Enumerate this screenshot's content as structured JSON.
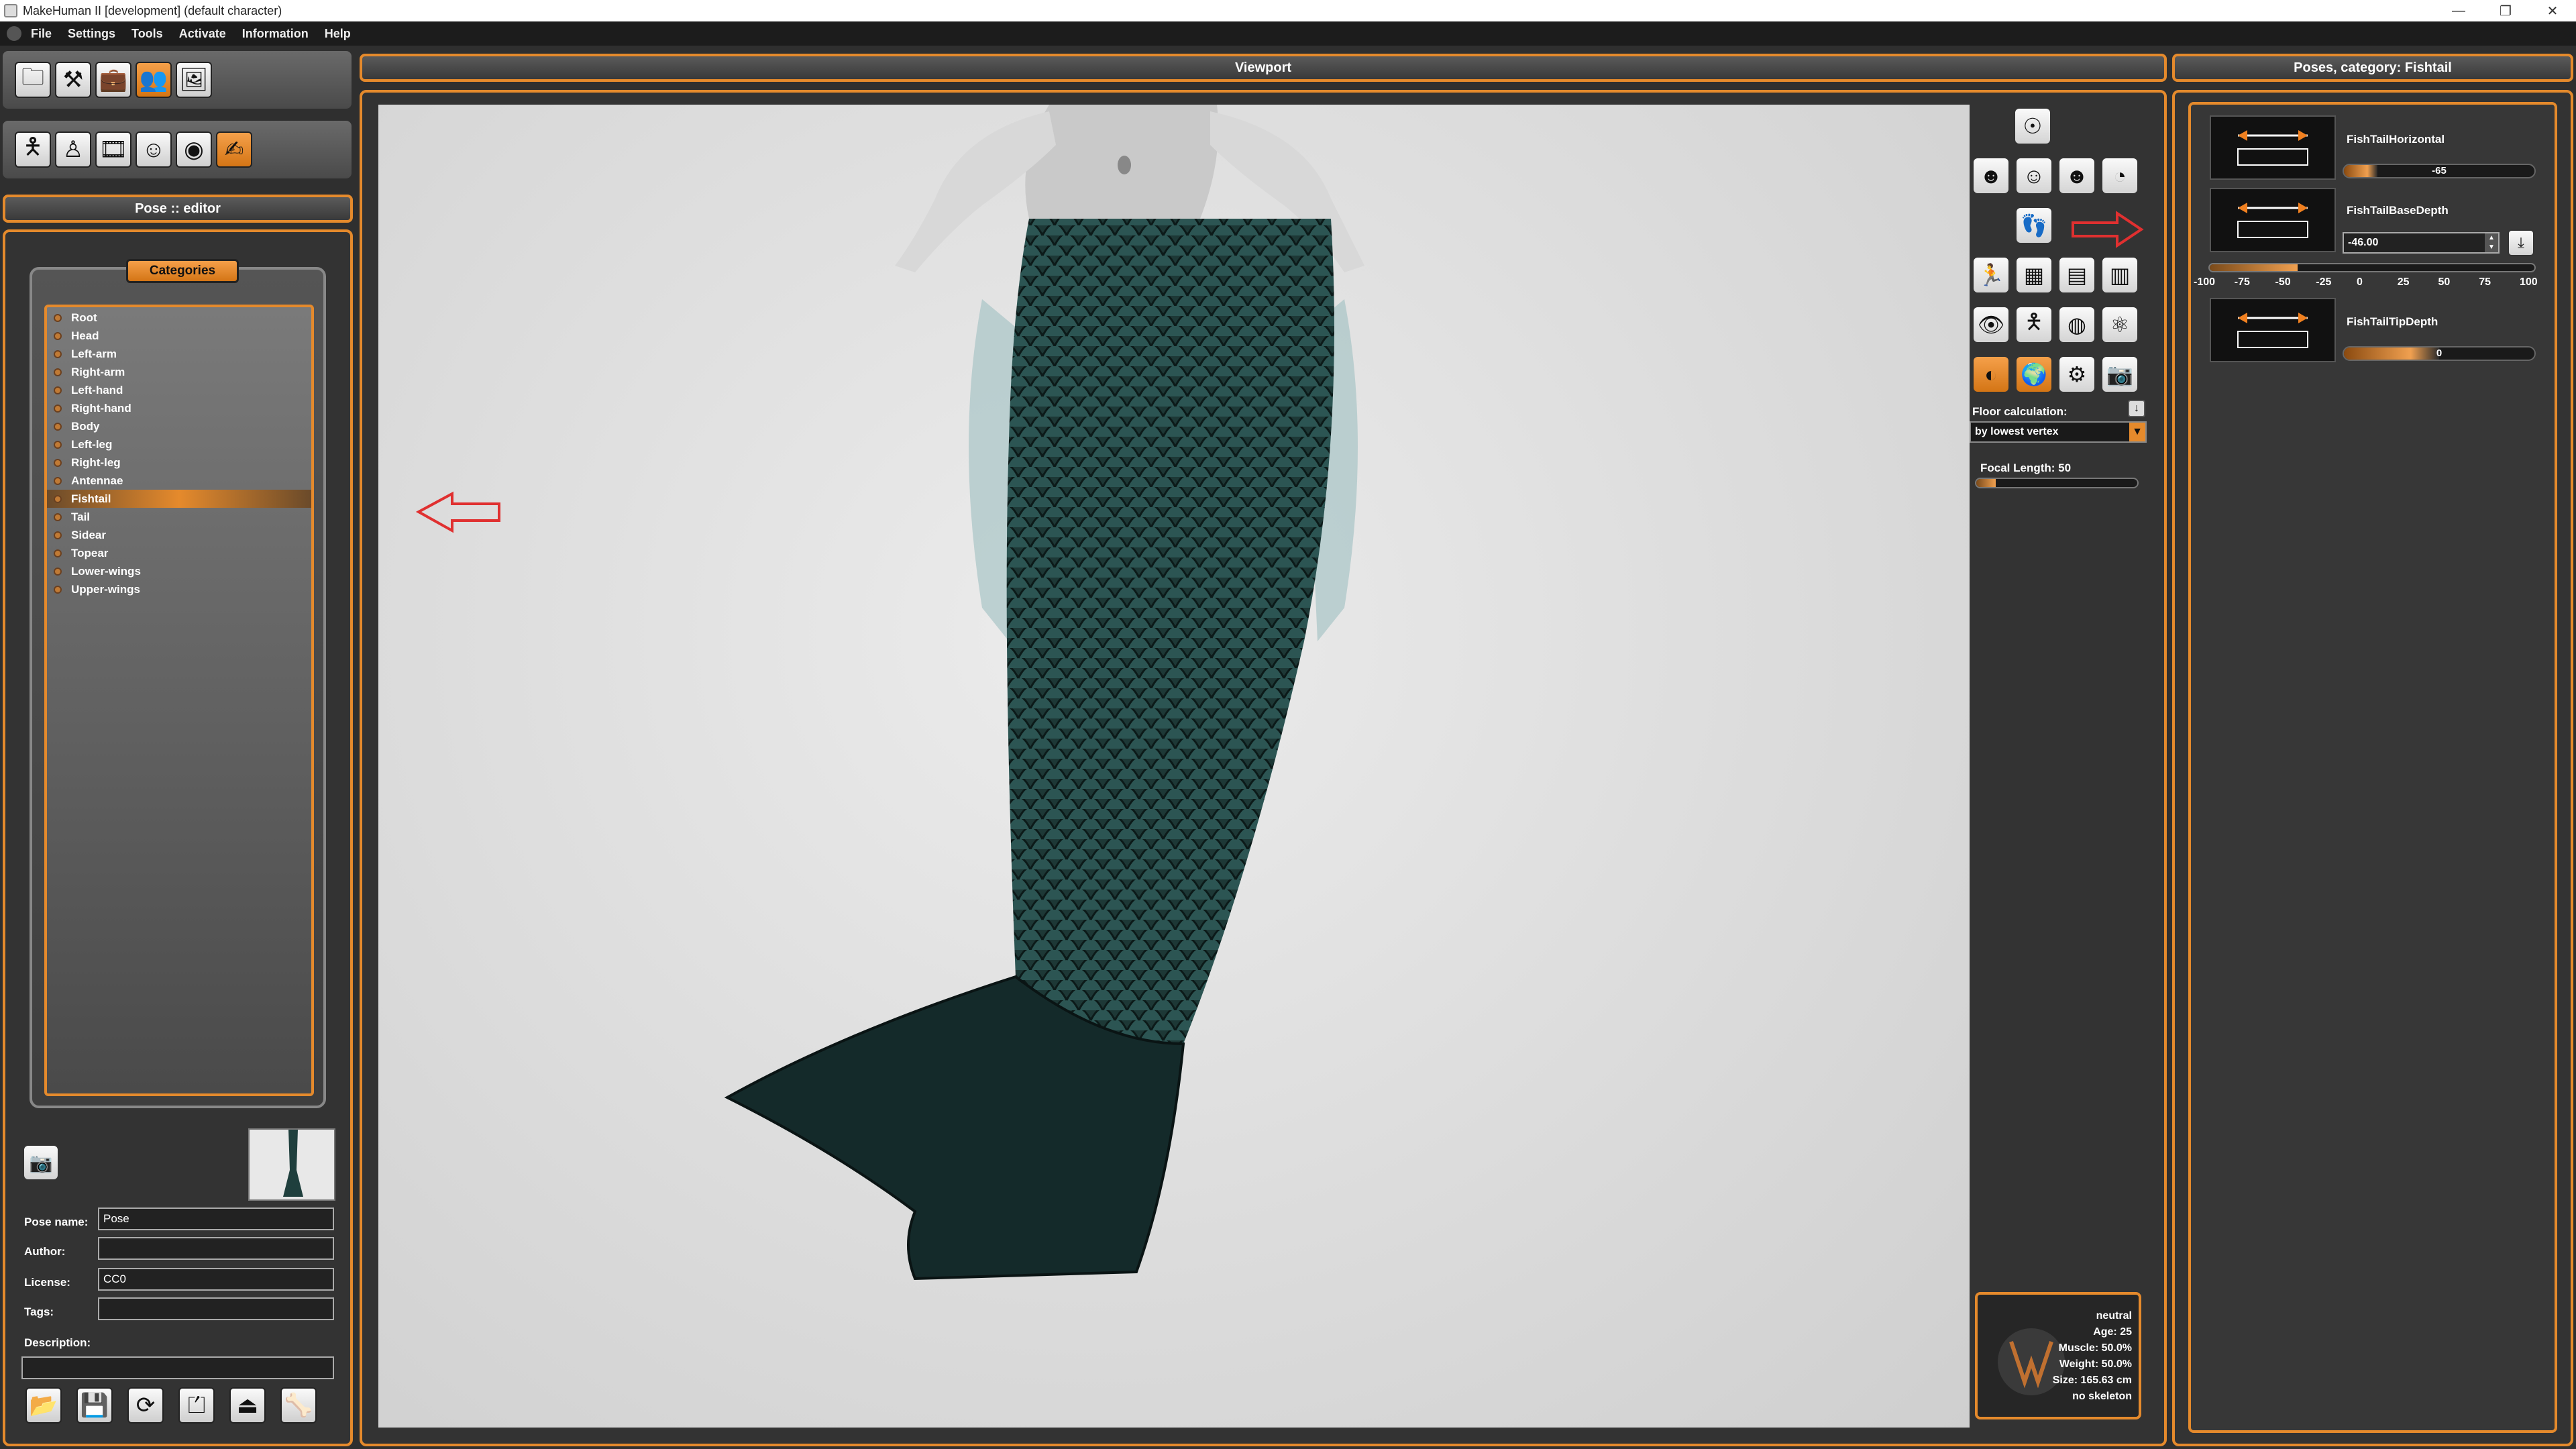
{
  "window": {
    "title": "MakeHuman II [development]  (default character)",
    "controls": [
      "—",
      "❐",
      "✕"
    ]
  },
  "menu": [
    "File",
    "Settings",
    "Tools",
    "Activate",
    "Information",
    "Help"
  ],
  "left": {
    "panel_title": "Pose :: editor",
    "categories_title": "Categories",
    "categories": [
      "Root",
      "Head",
      "Left-arm",
      "Right-arm",
      "Left-hand",
      "Right-hand",
      "Body",
      "Left-leg",
      "Right-leg",
      "Antennae",
      "Fishtail",
      "Tail",
      "Sidear",
      "Topear",
      "Lower-wings",
      "Upper-wings"
    ],
    "selected_category": "Fishtail",
    "form": {
      "pose_name_label": "Pose name:",
      "pose_name_value": "Pose",
      "author_label": "Author:",
      "author_value": "",
      "license_label": "License:",
      "license_value": "CC0",
      "tags_label": "Tags:",
      "tags_value": "",
      "description_label": "Description:",
      "description_value": ""
    }
  },
  "viewport": {
    "title": "Viewport",
    "floor_label": "Floor calculation:",
    "floor_value": "by lowest vertex",
    "focal_label": "Focal Length: 50",
    "focal_fraction": 0.12,
    "info": {
      "expression": "neutral",
      "age": "Age: 25",
      "muscle": "Muscle: 50.0%",
      "weight": "Weight: 50.0%",
      "size": "Size: 165.63 cm",
      "skeleton": "no skeleton"
    }
  },
  "right": {
    "panel_title": "Poses, category: Fishtail",
    "sliders": [
      {
        "name": "FishTailHorizontal",
        "value": "-65",
        "fraction": 0.175
      },
      {
        "name": "FishTailBaseDepth",
        "value": "-46.00",
        "fraction": 0.27
      },
      {
        "name": "FishTailTipDepth",
        "value": "0",
        "fraction": 0.5
      }
    ],
    "scale_ticks": [
      "-100",
      "-75",
      "-50",
      "-25",
      "0",
      "25",
      "50",
      "75",
      "100"
    ]
  },
  "colors": {
    "accent": "#e58a2c",
    "panel_bg": "#333333",
    "canvas_bg": "#dedede",
    "tail": "#1f3f3d"
  }
}
